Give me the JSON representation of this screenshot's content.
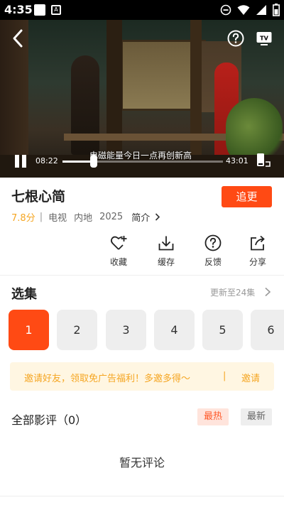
{
  "status_bar": {
    "time": "4:35"
  },
  "player": {
    "danmaku": "电磁能量今日一点再创新高",
    "current_time": "08:22",
    "duration": "43:01",
    "progress": 0.195
  },
  "show": {
    "title": "七根心简",
    "follow_label": "追更",
    "score": "7.8分",
    "separator": "|",
    "category": "电视",
    "region": "内地",
    "year": "2025",
    "intro_label": "简介"
  },
  "actions": [
    {
      "label": "收藏",
      "icon": "heart-plus-icon"
    },
    {
      "label": "缓存",
      "icon": "download-icon"
    },
    {
      "label": "反馈",
      "icon": "question-icon"
    },
    {
      "label": "分享",
      "icon": "share-icon"
    }
  ],
  "episodes": {
    "title": "选集",
    "update_text": "更新至24集",
    "items": [
      "1",
      "2",
      "3",
      "4",
      "5",
      "6"
    ],
    "active_index": 0
  },
  "invite": {
    "text": "邀请好友，领取免广告福利！多邀多得～",
    "divider": "|",
    "button": "邀请"
  },
  "reviews": {
    "title": "全部影评（0）",
    "sort_hot": "最热",
    "sort_new": "最新",
    "empty_text": "暂无评论"
  },
  "colors": {
    "accent": "#ff4a14",
    "score": "#f5a623",
    "invite_bg": "#fff6e2"
  }
}
